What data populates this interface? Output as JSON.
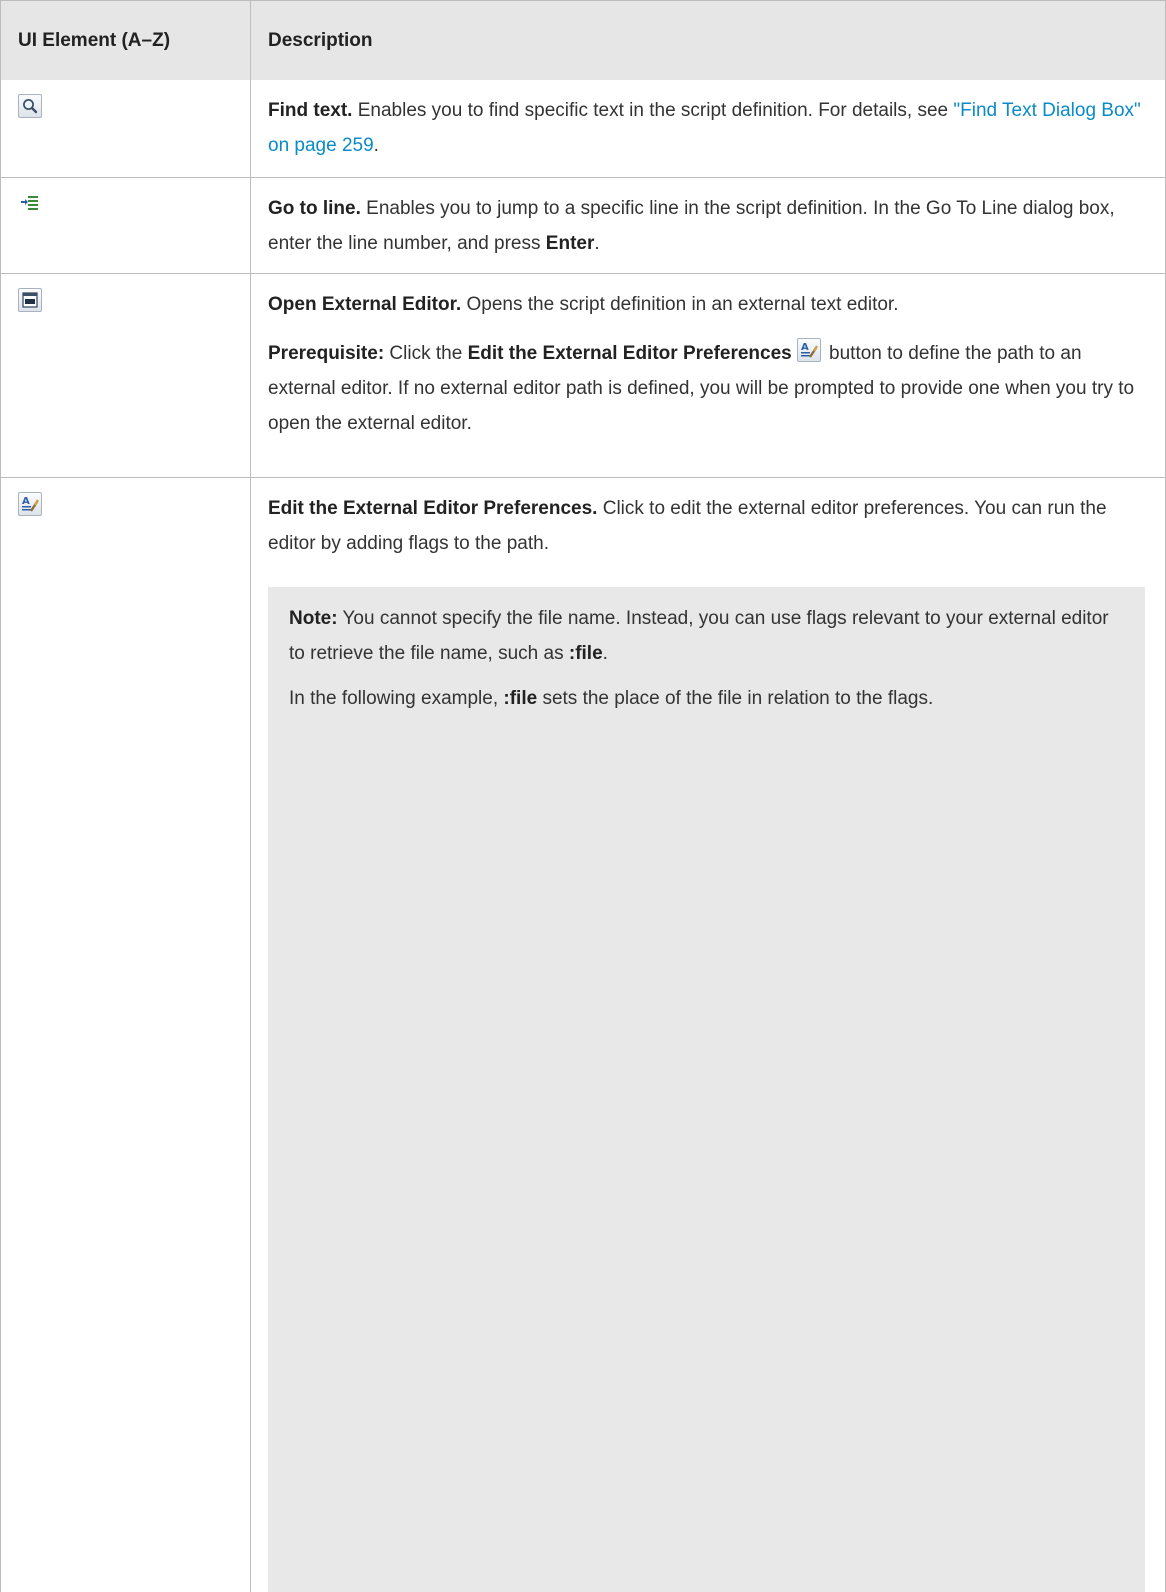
{
  "table": {
    "headers": {
      "ui_element": "UI Element (A–Z)",
      "description": "Description"
    },
    "rows": [
      {
        "icon": "find-text-icon",
        "title": "Find text.",
        "text": " Enables you to find specific text in the script definition. For details, see ",
        "link": "\"Find Text Dialog Box\" on page 259",
        "tail": "."
      },
      {
        "icon": "go-to-line-icon",
        "title": "Go to line.",
        "text": " Enables you to jump to a specific line in the script definition. In the Go To Line dialog box, enter the line number, and press ",
        "bold2": "Enter",
        "tail": "."
      },
      {
        "icon": "open-external-editor-icon",
        "title": "Open External Editor.",
        "text": " Opens the script definition in an external text editor.",
        "prereq_label": "Prerequisite:",
        "prereq_pre": " Click the ",
        "prereq_bold": "Edit the External Editor Preferences",
        "prereq_post": " button to define the path to an external editor. If no external editor path is defined, you will be prompted to provide one when you try to open the external editor."
      },
      {
        "icon": "edit-external-editor-preferences-icon",
        "title": "Edit the External Editor Preferences.",
        "text": " Click to edit the external editor preferences. You can run the editor by adding flags to the path.",
        "note_label": "Note:",
        "note_text": " You cannot specify the file name. Instead, you can use flags relevant to your external editor to retrieve the file name, such as ",
        "note_bold": ":file",
        "note_tail": ".",
        "example_pre": "In the following example, ",
        "example_bold": ":file",
        "example_post": " sets the place of the file in relation to the flags."
      }
    ]
  },
  "colors": {
    "header_bg": "#e6e6e6",
    "link": "#0a8ac9",
    "note_bg": "#e8e8e8",
    "border": "#bcbcbc"
  }
}
